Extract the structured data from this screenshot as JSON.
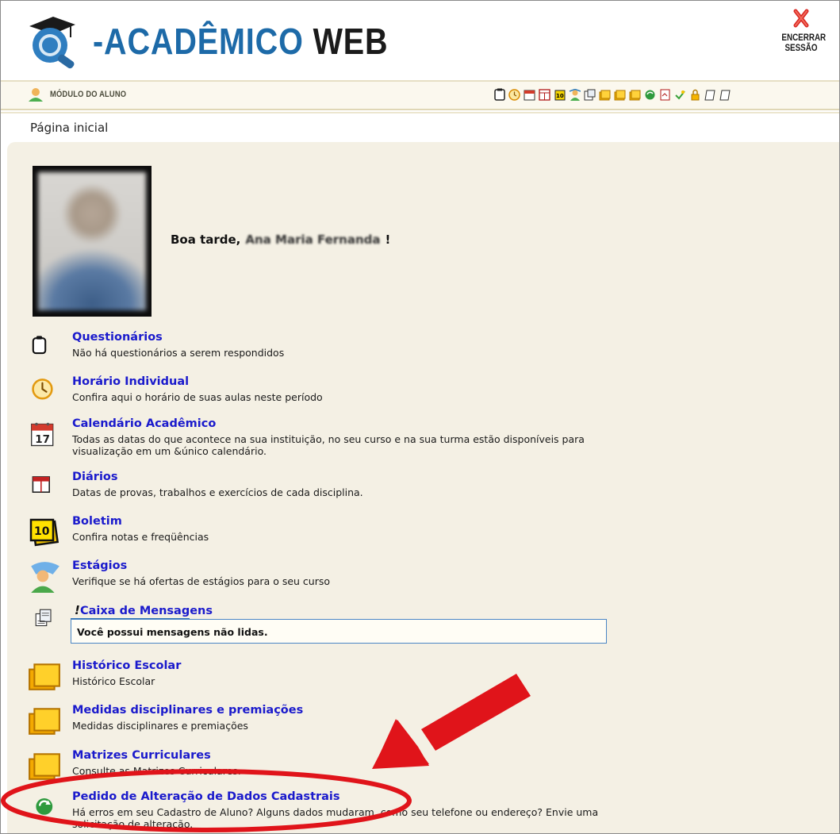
{
  "header": {
    "logo_prefix": "-ACADÊMICO",
    "logo_suffix": "WEB",
    "logout_label": "ENCERRAR\nSESSÃO"
  },
  "module_bar": {
    "label": "MÓDULO DO ALUNO",
    "toolbar_icons": [
      "clipboard-icon",
      "clock-icon",
      "calendar-icon",
      "diary-icon",
      "grade-icon",
      "internship-icon",
      "messages-icon",
      "folder-icon",
      "folder-icon",
      "folder-icon",
      "refresh-icon",
      "report-icon",
      "checkmark-icon",
      "lock-icon",
      "document-icon",
      "document-icon"
    ]
  },
  "breadcrumb": "Página inicial",
  "greeting": {
    "prefix": "Boa tarde,",
    "name": "Ana Maria Fernanda",
    "suffix": "!"
  },
  "menu": [
    {
      "title": "Questionários",
      "desc": "Não há questionários a serem respondidos",
      "icon": "clipboard-icon"
    },
    {
      "title": "Horário Individual",
      "desc": "Confira aqui o horário de suas aulas neste período",
      "icon": "clock-icon"
    },
    {
      "title": "Calendário Acadêmico",
      "desc": "Todas as datas do que acontece na sua instituição, no seu curso e na sua turma estão disponíveis para visualização em um &único calendário.",
      "icon": "calendar-icon"
    },
    {
      "title": "Diários",
      "desc": "Datas de provas, trabalhos e exercícios de cada disciplina.",
      "icon": "diary-icon"
    },
    {
      "title": "Boletim",
      "desc": "Confira notas e freqüências",
      "icon": "grade-icon"
    },
    {
      "title": "Estágios",
      "desc": "Verifique se há ofertas de estágios para o seu curso",
      "icon": "internship-icon"
    },
    {
      "title": "Caixa de Mensagens",
      "desc": "",
      "icon": "messages-icon"
    },
    {
      "title": "Histórico Escolar",
      "desc": "Histórico Escolar",
      "icon": "folder-icon"
    },
    {
      "title": "Medidas disciplinares e premiações",
      "desc": "Medidas disciplinares e premiações",
      "icon": "folder-icon"
    },
    {
      "title": "Matrizes Curriculares",
      "desc": "Consulte as Matrizes Curriculares.",
      "icon": "folder-icon"
    },
    {
      "title": "Pedido de Alteração de Dados Cadastrais",
      "desc": "Há erros em seu Cadastro de Aluno? Alguns dados mudaram, como seu telefone ou endereço? Envie uma solicitação de alteração.",
      "icon": "refresh-icon"
    }
  ],
  "messages_notice": "Você possui mensagens não lidas.",
  "calendar_day": "17",
  "grade_number": "10",
  "colors": {
    "link": "#1a1acc",
    "logo_blue": "#1d6aa8",
    "panel_bg": "#f4f0e4",
    "annotation_red": "#e0141a"
  }
}
